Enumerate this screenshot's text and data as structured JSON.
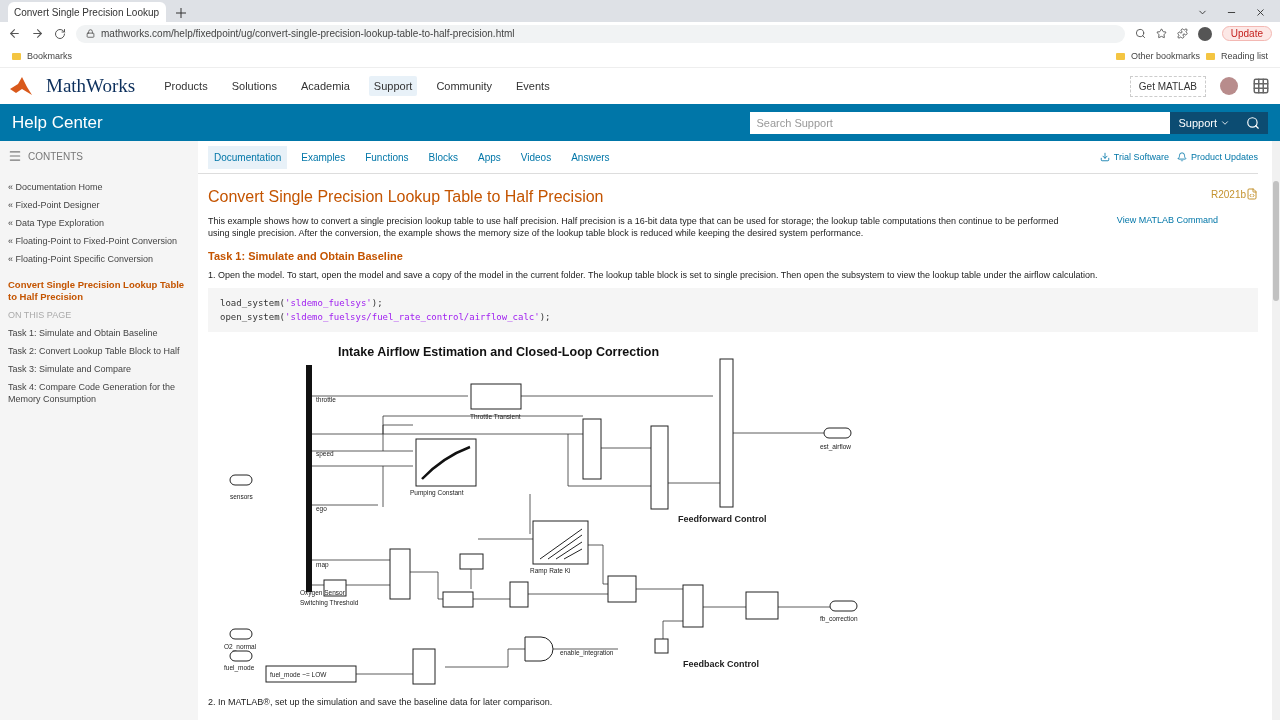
{
  "browser": {
    "tab_title": "Convert Single Precision Lookup",
    "url": "mathworks.com/help/fixedpoint/ug/convert-single-precision-lookup-table-to-half-precision.html",
    "bookmarks": [
      "Bookmarks"
    ],
    "right_bookmarks": [
      "Other bookmarks",
      "Reading list"
    ],
    "update_button": "Update"
  },
  "site_nav": {
    "logo": "MathWorks",
    "items": [
      {
        "label": "Products",
        "selected": false
      },
      {
        "label": "Solutions",
        "selected": false
      },
      {
        "label": "Academia",
        "selected": false
      },
      {
        "label": "Support",
        "selected": true
      },
      {
        "label": "Community",
        "selected": false
      },
      {
        "label": "Events",
        "selected": false
      }
    ],
    "get_button": "Get MATLAB"
  },
  "help_bar": {
    "title": "Help Center",
    "search_placeholder": "Search Support",
    "scope": "Support"
  },
  "sidebar": {
    "header": "CONTENTS",
    "links": [
      {
        "label": "« Documentation Home",
        "kind": "parent"
      },
      {
        "label": "« Fixed-Point Designer",
        "kind": "parent"
      },
      {
        "label": "« Data Type Exploration",
        "kind": "parent"
      },
      {
        "label": "« Floating-Point to Fixed-Point Conversion",
        "kind": "parent"
      },
      {
        "label": "« Floating-Point Specific Conversion",
        "kind": "parent"
      },
      {
        "label": "Convert Single Precision Lookup Table to Half Precision",
        "kind": "current"
      },
      {
        "label": "ON THIS PAGE",
        "kind": "section_header"
      },
      {
        "label": "Task 1: Simulate and Obtain Baseline",
        "kind": "section"
      },
      {
        "label": "Task 2: Convert Lookup Table Block to Half",
        "kind": "section"
      },
      {
        "label": "Task 3: Simulate and Compare",
        "kind": "section"
      },
      {
        "label": "Task 4: Compare Code Generation for the Memory Consumption",
        "kind": "section"
      }
    ]
  },
  "doc_tabs": [
    {
      "label": "Documentation",
      "selected": true
    },
    {
      "label": "Examples",
      "selected": false
    },
    {
      "label": "Functions",
      "selected": false
    },
    {
      "label": "Blocks",
      "selected": false
    },
    {
      "label": "Apps",
      "selected": false
    },
    {
      "label": "Videos",
      "selected": false
    },
    {
      "label": "Answers",
      "selected": false
    }
  ],
  "doc_actions": [
    "Trial Software",
    "Product Updates"
  ],
  "article": {
    "title": "Convert Single Precision Lookup Table to Half Precision",
    "version": "R2021b",
    "command_link": "View MATLAB Command",
    "intro": "This example shows how to convert a single precision lookup table to use half precision. Half precision is a 16-bit data type that can be used for storage; the lookup table computations then continue to be performed using single precision. After the conversion, the example shows the memory size of the lookup table block is reduced while keeping the desired system performance.",
    "task_heading": "Task 1: Simulate and Obtain Baseline",
    "step1": "1. Open the model. To start, open the model and save a copy of the model in the current folder. The lookup table block is set to single precision. Then open the subsystem to view the lookup table under the airflow calculation.",
    "code": [
      {
        "fn": "load_system(",
        "arg": "'sldemo_fuelsys'",
        "end": ");"
      },
      {
        "fn": "open_system(",
        "arg": "'sldemo_fuelsys/fuel_rate_control/airflow_calc'",
        "end": ");"
      }
    ],
    "diagram": {
      "title": "Intake Airflow Estimation and Closed-Loop Correction",
      "labels": [
        "sensors",
        "throttle",
        "speed",
        "ego",
        "map",
        "Throttle Transient",
        "Pumping Constant",
        "Ramp Rate Ki",
        "Oxygen Sensor",
        "Switching Threshold",
        "O2_normal",
        "fuel_mode",
        "fuel_mode ~= LOW",
        "enable_integration",
        "Feedforward Control",
        "Feedback Control",
        "est_airflow",
        "fb_correction"
      ]
    },
    "step2": "2. In MATLAB®, set up the simulation and save the baseline data for later comparison."
  }
}
